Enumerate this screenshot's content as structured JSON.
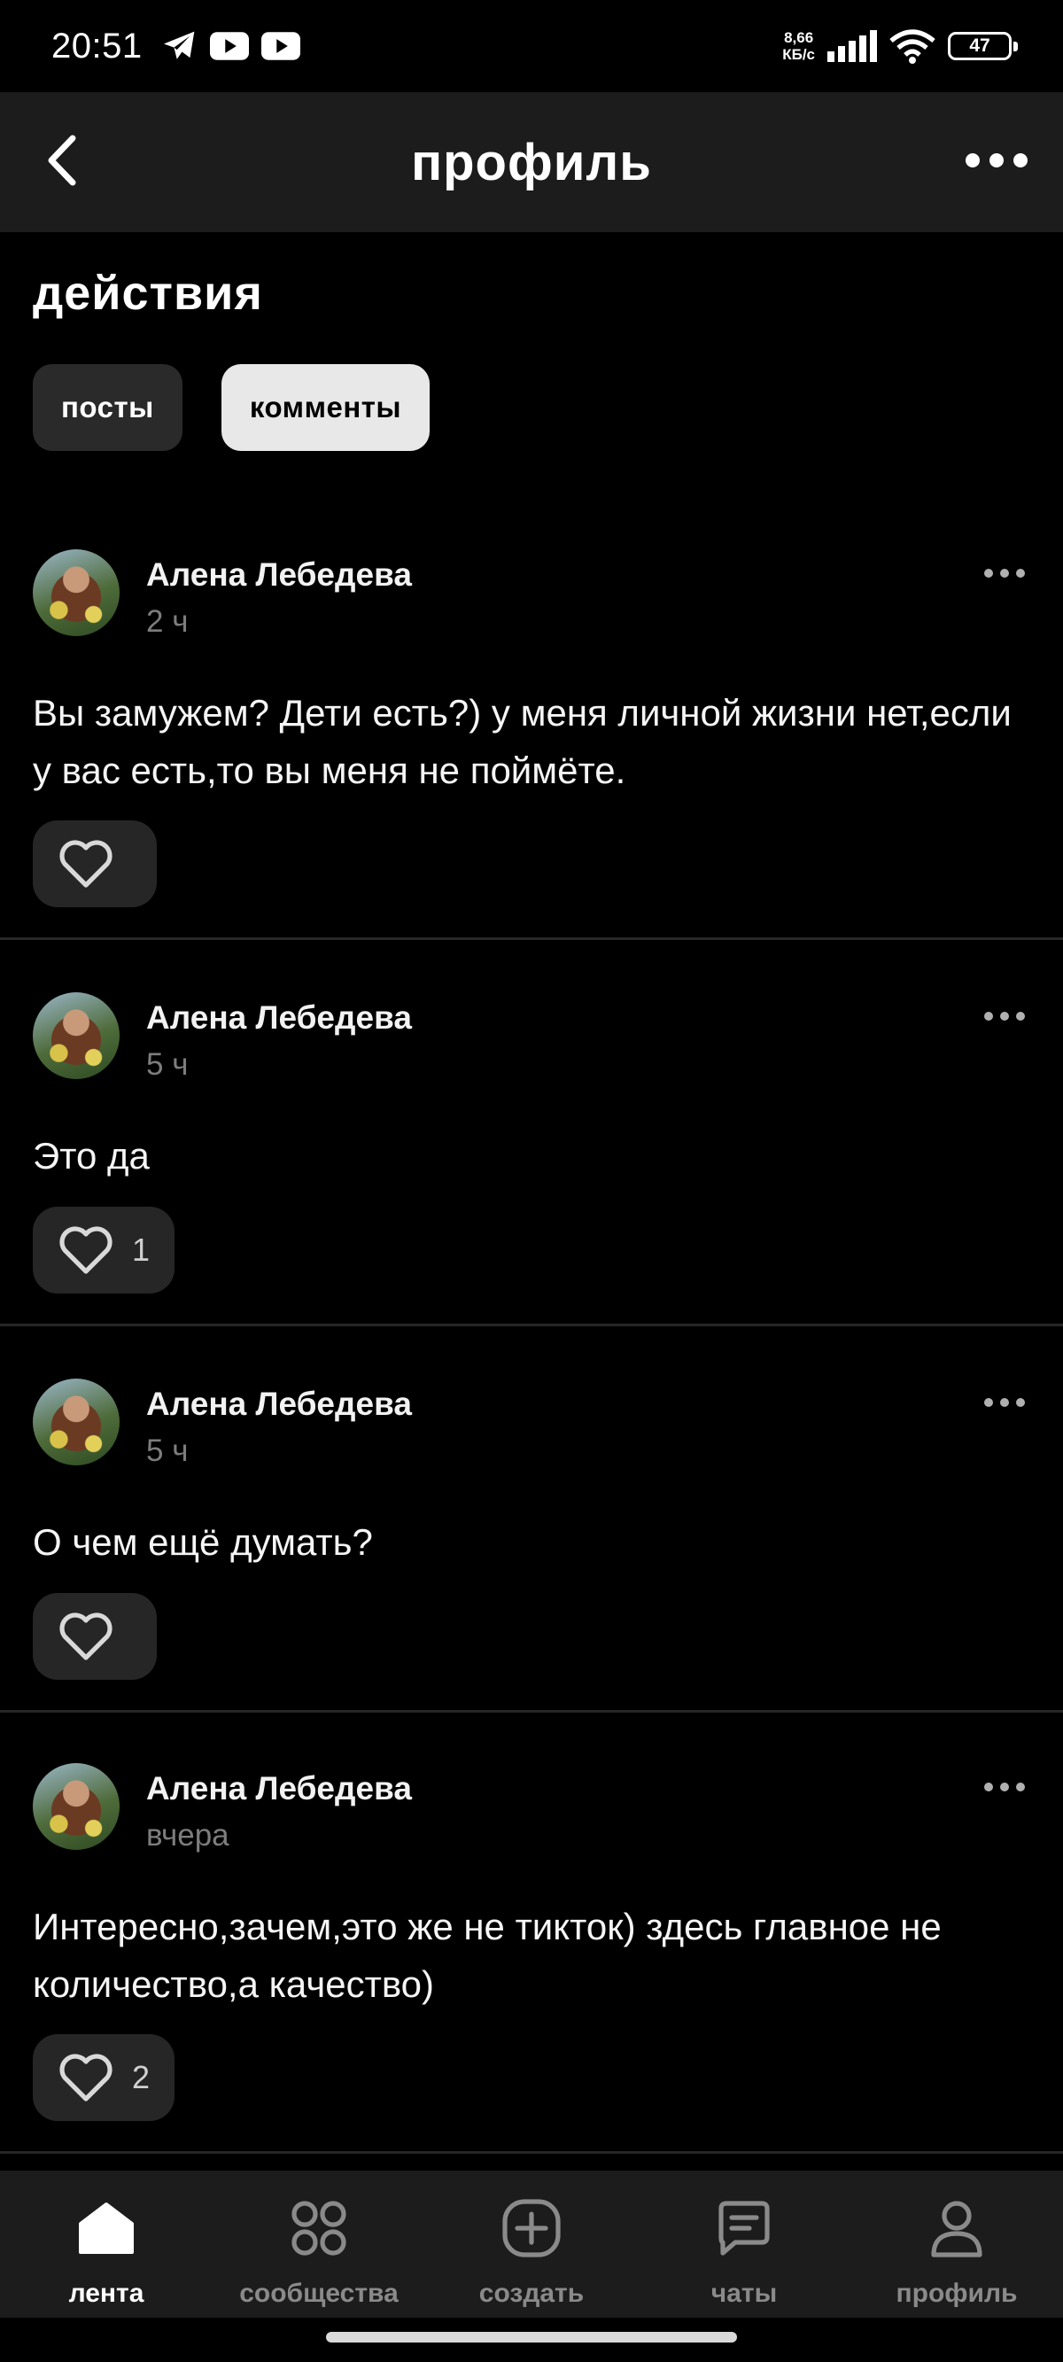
{
  "status_bar": {
    "time": "20:51",
    "speed_value": "8,66",
    "speed_unit": "КБ/с",
    "battery": "47"
  },
  "header": {
    "title": "профиль"
  },
  "section": {
    "title": "действия",
    "tabs": [
      {
        "label": "посты",
        "active": false
      },
      {
        "label": "комменты",
        "active": true
      }
    ]
  },
  "comments": [
    {
      "author": "Алена Лебедева",
      "time": "2 ч",
      "text": "Вы замужем? Дети есть?) у меня личной жизни нет,если у вас есть,то вы меня не поймёте.",
      "likes": ""
    },
    {
      "author": "Алена Лебедева",
      "time": "5 ч",
      "text": "Это да",
      "likes": "1"
    },
    {
      "author": "Алена Лебедева",
      "time": "5 ч",
      "text": "О чем ещё думать?",
      "likes": ""
    },
    {
      "author": "Алена Лебедева",
      "time": "вчера",
      "text": "Интересно,зачем,это же не тикток) здесь главное не количество,а качество)",
      "likes": "2"
    }
  ],
  "bottom_nav": [
    {
      "label": "лента",
      "icon": "home-icon",
      "active": true
    },
    {
      "label": "сообщества",
      "icon": "grid-icon",
      "active": false
    },
    {
      "label": "создать",
      "icon": "plus-square-icon",
      "active": false
    },
    {
      "label": "чаты",
      "icon": "chat-icon",
      "active": false
    },
    {
      "label": "профиль",
      "icon": "person-icon",
      "active": false
    }
  ]
}
